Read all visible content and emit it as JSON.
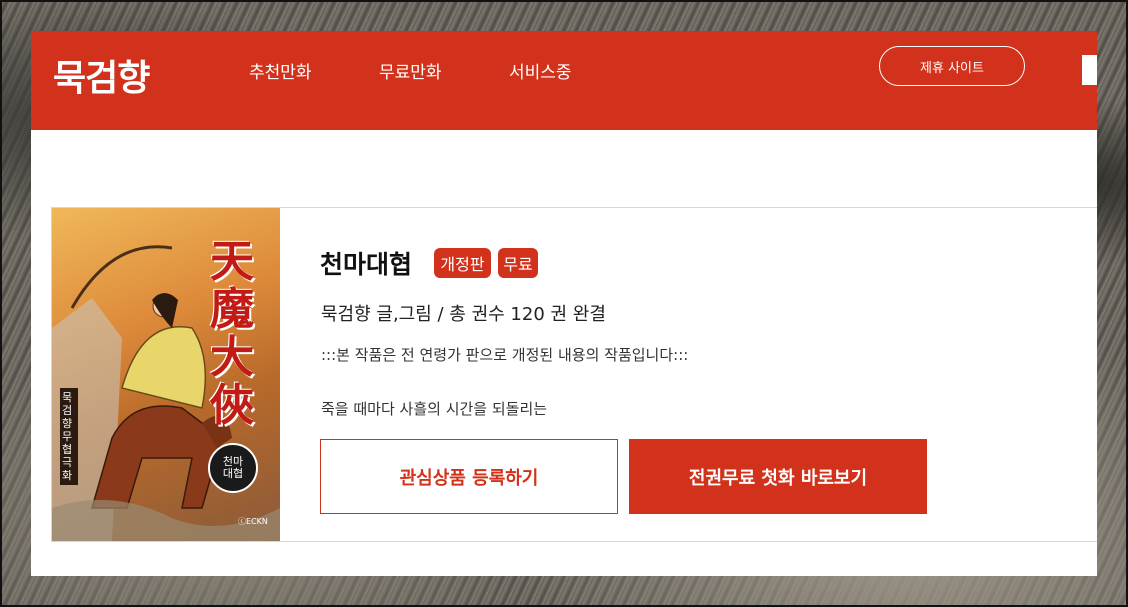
{
  "header": {
    "logo": "묵검향",
    "nav": [
      "추천만화",
      "무료만화",
      "서비스중"
    ],
    "partner_button": "제휴 사이트",
    "bookmark_icon": "bookmark-icon"
  },
  "book": {
    "title": "천마대협",
    "badges": [
      "개정판",
      "무료"
    ],
    "author_line": "묵검향 글,그림 / 총 권수 120 권 완결",
    "notice": ":::본 작품은 전 연령가 판으로 개정된 내용의 작품입니다:::",
    "description": "죽을 때마다 사흘의 시간을 되돌리는",
    "cover": {
      "title_hanja": "天魔大俠",
      "subtitle": "천마대협",
      "side_text": "묵검향 무협극화",
      "publisher": "ⓒECKN"
    }
  },
  "buttons": {
    "wishlist": "관심상품 등록하기",
    "read_first": "전권무료 첫화 바로보기"
  },
  "colors": {
    "brand": "#d2321b"
  }
}
